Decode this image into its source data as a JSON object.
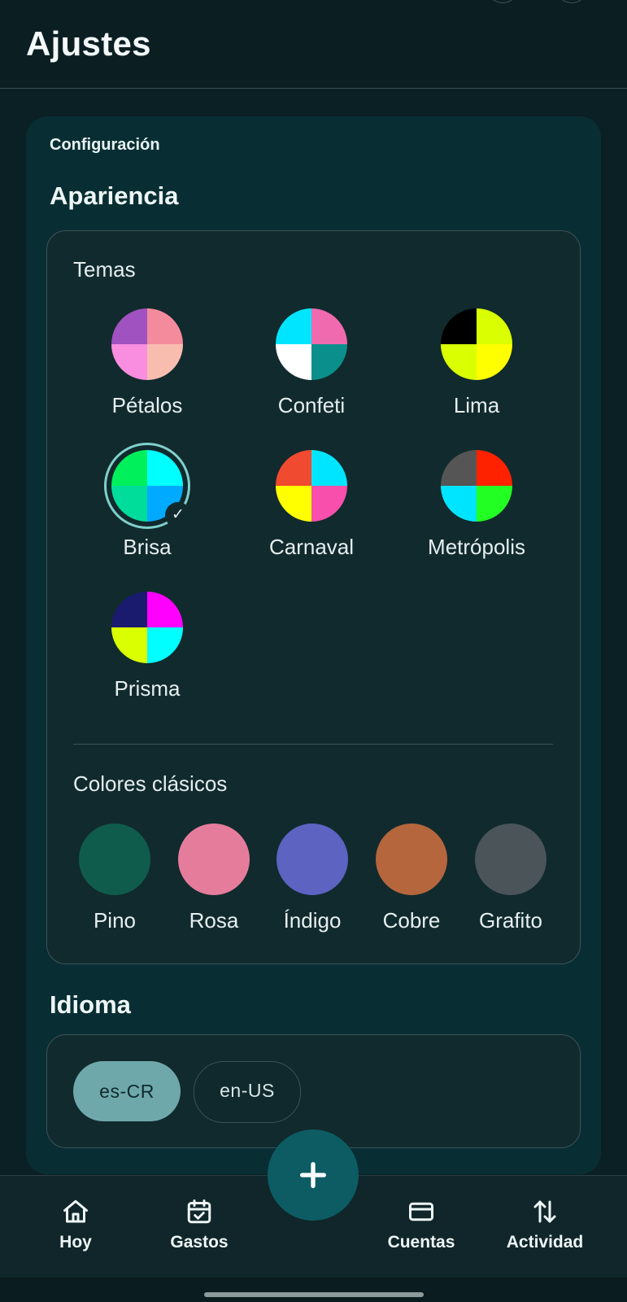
{
  "header": {
    "title": "Ajustes"
  },
  "settings": {
    "section": "Configuración",
    "appearance": {
      "heading": "Apariencia",
      "themes_label": "Temas",
      "selected_theme": "Brisa",
      "themes": [
        {
          "name": "Pétalos",
          "colors": [
            "#a052c0",
            "#f48b9c",
            "#f98ee0",
            "#f9bdb0"
          ]
        },
        {
          "name": "Confeti",
          "colors": [
            "#00e5ff",
            "#f06aaf",
            "#ffffff",
            "#0a8f8c"
          ]
        },
        {
          "name": "Lima",
          "colors": [
            "#000000",
            "#d9ff00",
            "#d9ff00",
            "#ffff00"
          ]
        },
        {
          "name": "Brisa",
          "colors": [
            "#00f05c",
            "#00ffff",
            "#00dd9a",
            "#00aaff"
          ]
        },
        {
          "name": "Carnaval",
          "colors": [
            "#f04a30",
            "#00e5ff",
            "#ffff00",
            "#f74fab"
          ]
        },
        {
          "name": "Metrópolis",
          "colors": [
            "#555555",
            "#ff2200",
            "#00e5ff",
            "#22ff22"
          ]
        },
        {
          "name": "Prisma",
          "colors": [
            "#1a1a6e",
            "#ff00ff",
            "#d9ff00",
            "#00ffff"
          ]
        }
      ],
      "classic_label": "Colores clásicos",
      "classic_colors": [
        {
          "name": "Pino",
          "color": "#0f5c4d"
        },
        {
          "name": "Rosa",
          "color": "#e67c9c"
        },
        {
          "name": "Índigo",
          "color": "#5c63c1"
        },
        {
          "name": "Cobre",
          "color": "#b5663d"
        },
        {
          "name": "Grafito",
          "color": "#4a5459"
        }
      ]
    },
    "language": {
      "heading": "Idioma",
      "selected": "es-CR",
      "options": [
        "es-CR",
        "en-US"
      ]
    }
  },
  "bottom_nav": {
    "items": [
      {
        "label": "Hoy",
        "icon": "home-icon"
      },
      {
        "label": "Gastos",
        "icon": "calendar-check-icon"
      },
      {
        "label": "Cuentas",
        "icon": "card-icon"
      },
      {
        "label": "Actividad",
        "icon": "swap-vertical-icon"
      }
    ],
    "fab_icon": "plus-icon"
  },
  "colors": {
    "background": "#0b2024",
    "panel": "#082e33",
    "card": "#112a2d",
    "accent": "#6fa8ab",
    "fab": "#0d5c63"
  }
}
